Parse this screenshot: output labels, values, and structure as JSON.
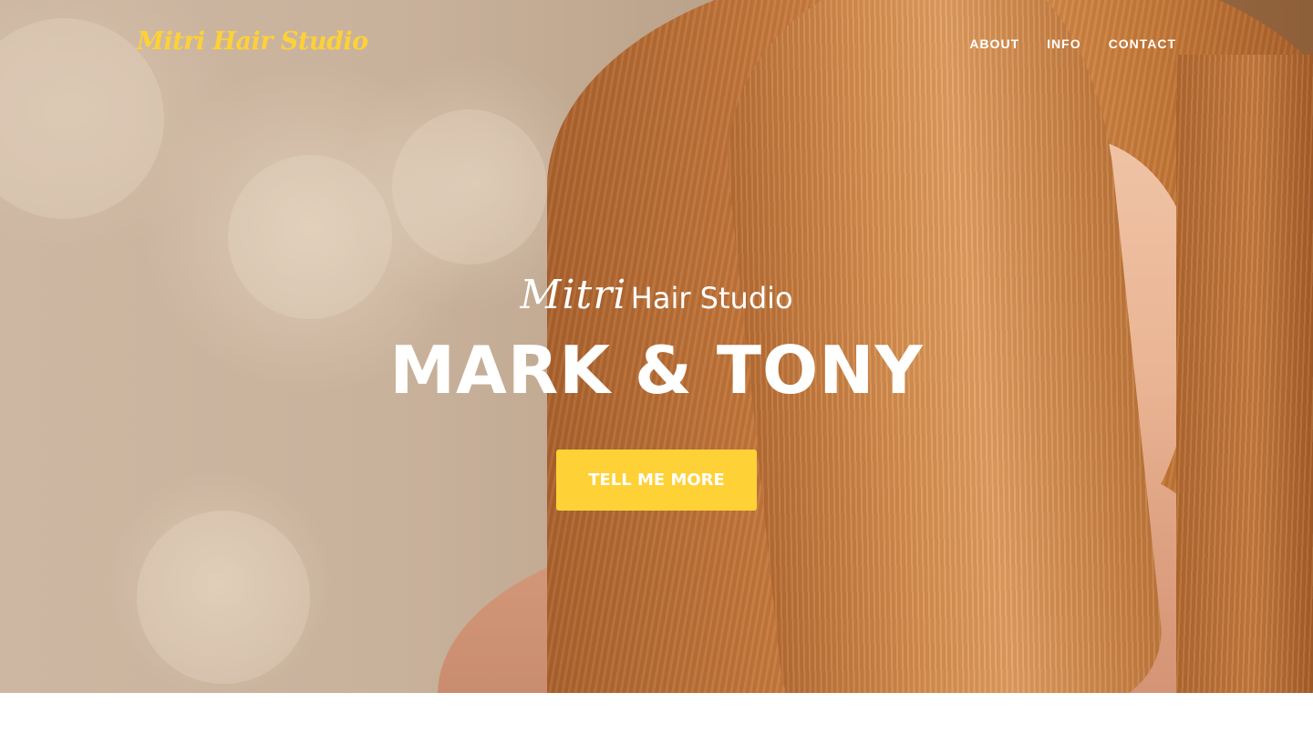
{
  "header": {
    "logo_text": "Mitri Hair Studio",
    "nav": [
      {
        "label": "ABOUT"
      },
      {
        "label": "INFO"
      },
      {
        "label": "CONTACT"
      }
    ]
  },
  "hero": {
    "subtitle_script": "Mitri",
    "subtitle_plain": "Hair Studio",
    "title": "MARK & TONY",
    "cta_label": "TELL ME MORE"
  },
  "colors": {
    "accent": "#fed136",
    "text_on_hero": "#ffffff"
  }
}
